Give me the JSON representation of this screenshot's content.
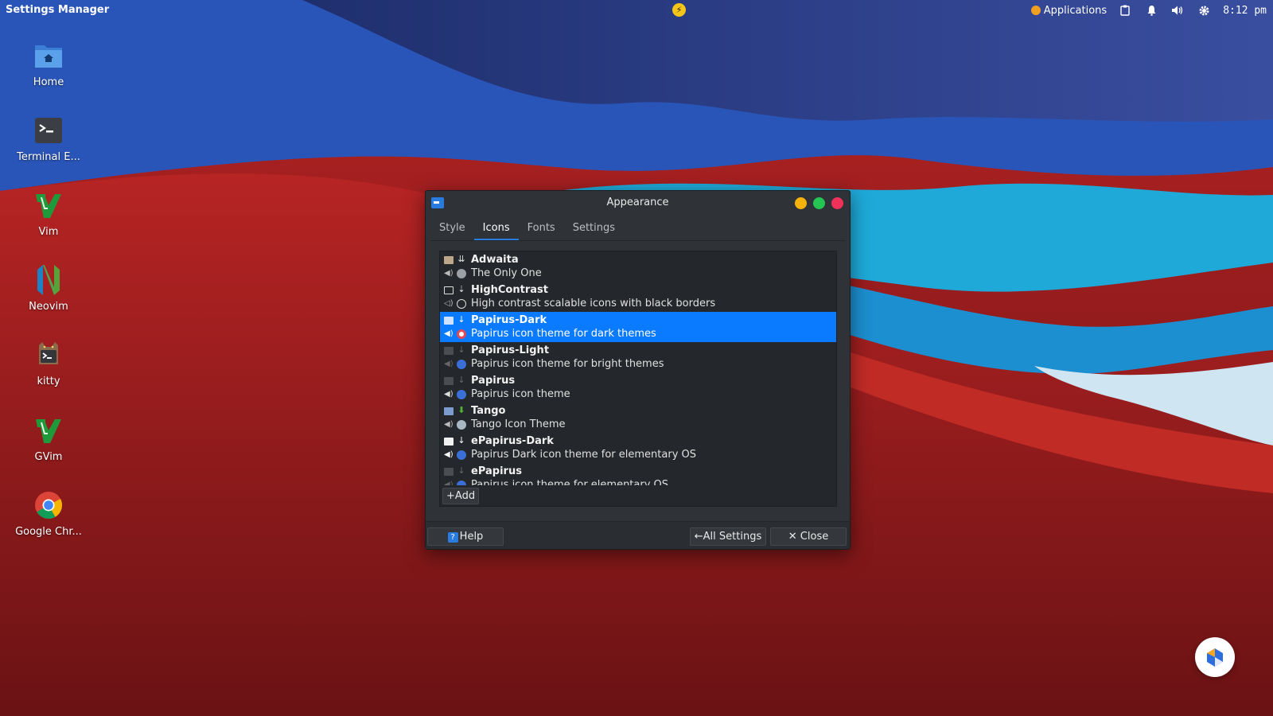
{
  "panel": {
    "app_name": "Settings Manager",
    "applications_label": "Applications",
    "clock": "8:12 pm"
  },
  "desktop": [
    {
      "label": "Home"
    },
    {
      "label": "Terminal E..."
    },
    {
      "label": "Vim"
    },
    {
      "label": "Neovim"
    },
    {
      "label": "kitty"
    },
    {
      "label": "GVim"
    },
    {
      "label": "Google Chr..."
    }
  ],
  "window": {
    "title": "Appearance",
    "tabs": [
      "Style",
      "Icons",
      "Fonts",
      "Settings"
    ],
    "active_tab": "Icons",
    "themes": [
      {
        "name": "Adwaita",
        "desc": "The Only One"
      },
      {
        "name": "HighContrast",
        "desc": "High contrast scalable icons with black borders"
      },
      {
        "name": "Papirus-Dark",
        "desc": "Papirus icon theme for dark themes",
        "selected": true
      },
      {
        "name": "Papirus-Light",
        "desc": "Papirus icon theme for bright themes"
      },
      {
        "name": "Papirus",
        "desc": "Papirus icon theme"
      },
      {
        "name": "Tango",
        "desc": "Tango Icon Theme"
      },
      {
        "name": "ePapirus-Dark",
        "desc": "Papirus Dark icon theme for elementary OS"
      },
      {
        "name": "ePapirus",
        "desc": "Papirus icon theme for elementary OS"
      }
    ],
    "add_label": "Add",
    "help_label": "Help",
    "all_settings_label": "All Settings",
    "close_label": "Close"
  },
  "colors": {
    "accent": "#0a7aff",
    "minimize": "#f5b20b",
    "maximize": "#25c553",
    "close": "#f0325b"
  }
}
